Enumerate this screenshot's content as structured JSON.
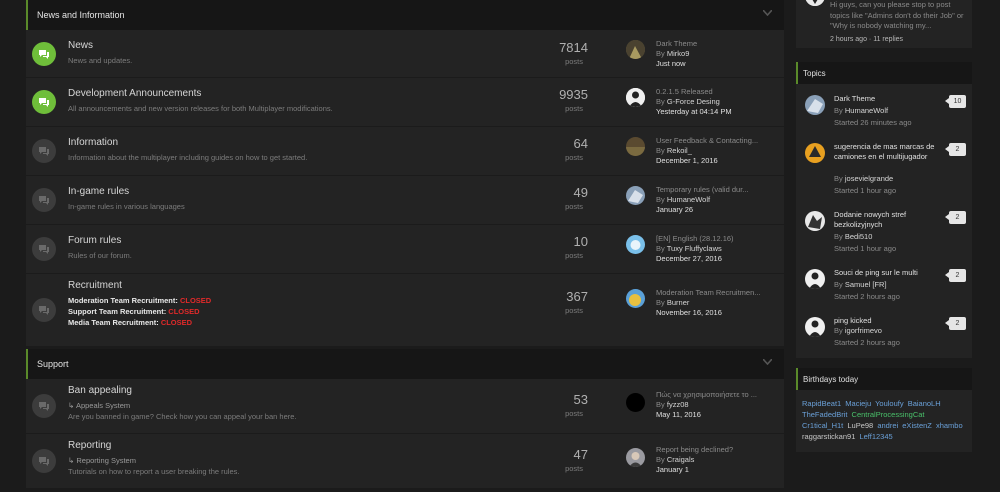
{
  "categories": {
    "news": {
      "title": "News and Information"
    },
    "support": {
      "title": "Support"
    }
  },
  "forums": [
    {
      "name": "News",
      "desc": "News and updates.",
      "count": "7814",
      "count_label": "posts",
      "last_title": "Dark Theme",
      "last_by_prefix": "By",
      "last_by": "Mirko9",
      "last_date": "Just now"
    },
    {
      "name": "Development Announcements",
      "desc": "All announcements and new version releases for both Multiplayer modifications.",
      "count": "9935",
      "count_label": "posts",
      "last_title": "0.2.1.5 Released",
      "last_by_prefix": "By",
      "last_by": "G-Force Desing",
      "last_date": "Yesterday at 04:14 PM"
    },
    {
      "name": "Information",
      "desc": "Information about the multiplayer including guides on how to get started.",
      "count": "64",
      "count_label": "posts",
      "last_title": "User Feedback & Contacting...",
      "last_by_prefix": "By",
      "last_by": "Rekoil_",
      "last_date": "December 1, 2016"
    },
    {
      "name": "In-game rules",
      "desc": "In-game rules in various languages",
      "count": "49",
      "count_label": "posts",
      "last_title": "Temporary rules (valid dur...",
      "last_by_prefix": "By",
      "last_by": "HumaneWolf",
      "last_date": "January 26"
    },
    {
      "name": "Forum rules",
      "desc": "Rules of our forum.",
      "count": "10",
      "count_label": "posts",
      "last_title": "[EN] English (28.12.16)",
      "last_by_prefix": "By",
      "last_by": "Tuxy Fluffyclaws",
      "last_date": "December 27, 2016"
    },
    {
      "name": "Recruitment",
      "count": "367",
      "count_label": "posts",
      "last_title": "Moderation Team Recruitmen...",
      "last_by_prefix": "By",
      "last_by": "Burner",
      "last_date": "November 16, 2016",
      "lines": [
        {
          "label": "Moderation Team Recruitment:",
          "status": "CLOSED"
        },
        {
          "label": "Support Team Recruitment:",
          "status": "CLOSED"
        },
        {
          "label": "Media Team Recruitment:",
          "status": "CLOSED"
        }
      ]
    },
    {
      "name": "Ban appealing",
      "sub": "↳ Appeals System",
      "desc": "Are you banned in game? Check how you can appeal your ban here.",
      "count": "53",
      "count_label": "posts",
      "last_title": "Πώς να χρησιμοποιήσετε το ...",
      "last_by_prefix": "By",
      "last_by": "fyzz08",
      "last_date": "May 11, 2016"
    },
    {
      "name": "Reporting",
      "sub": "↳ Reporting System",
      "desc": "Tutorials on how to report a user breaking the rules.",
      "count": "47",
      "count_label": "posts",
      "last_title": "Report being declined?",
      "last_by_prefix": "By",
      "last_by": "Craigals",
      "last_date": "January 1"
    }
  ],
  "activity": {
    "text": "Hi guys, can you please stop to post topics like \"Admins don't do their Job\" or \"Why is nobody watching my...",
    "meta": "2 hours ago · 11 replies"
  },
  "topics_box": {
    "title": "Topics",
    "items": [
      {
        "title": "Dark Theme",
        "by_prefix": "By",
        "by": "HumaneWolf",
        "started": "Started 26 minutes ago",
        "replies": "10"
      },
      {
        "title": "sugerencia de mas marcas de camiones en el multijugador",
        "by_prefix": "By",
        "by": "josevielgrande",
        "started": "Started 1 hour ago",
        "replies": "2"
      },
      {
        "title": "Dodanie nowych stref bezkolizyjnych",
        "by_prefix": "By",
        "by": "Bedi510",
        "started": "Started 1 hour ago",
        "replies": "2"
      },
      {
        "title": "Souci de ping sur le multi",
        "by_prefix": "By",
        "by": "Samuel [FR]",
        "started": "Started 2 hours ago",
        "replies": "2"
      },
      {
        "title": "ping kicked",
        "by_prefix": "By",
        "by": "igorfrimevo",
        "started": "Started 2 hours ago",
        "replies": "2"
      }
    ]
  },
  "birthdays": {
    "title": "Birthdays today",
    "names": [
      {
        "name": "RapidBeat1",
        "color": "#6aa0d8"
      },
      {
        "name": "Macieju",
        "color": "#6aa0d8"
      },
      {
        "name": "Youloufy",
        "color": "#6aa0d8"
      },
      {
        "name": "BaianoLH",
        "color": "#6aa0d8"
      },
      {
        "name": "TheFadedBrit",
        "color": "#6aa0d8"
      },
      {
        "name": "CentralProcessingCat",
        "color": "#49c06a"
      },
      {
        "name": "Cr1tical_H1t",
        "color": "#6aa0d8"
      },
      {
        "name": "LuPe98",
        "color": "#c8c8c8"
      },
      {
        "name": "andrei",
        "color": "#6aa0d8"
      },
      {
        "name": "eXistenZ",
        "color": "#6aa0d8"
      },
      {
        "name": "xhambo",
        "color": "#6aa0d8"
      },
      {
        "name": "raggarstickan91",
        "color": "#c8c8c8"
      },
      {
        "name": "Leff12345",
        "color": "#6aa0d8"
      }
    ]
  },
  "colors": {
    "accent": "#5a8a2a",
    "unread": "#6fbe3a",
    "closed": "#e02a2a"
  }
}
